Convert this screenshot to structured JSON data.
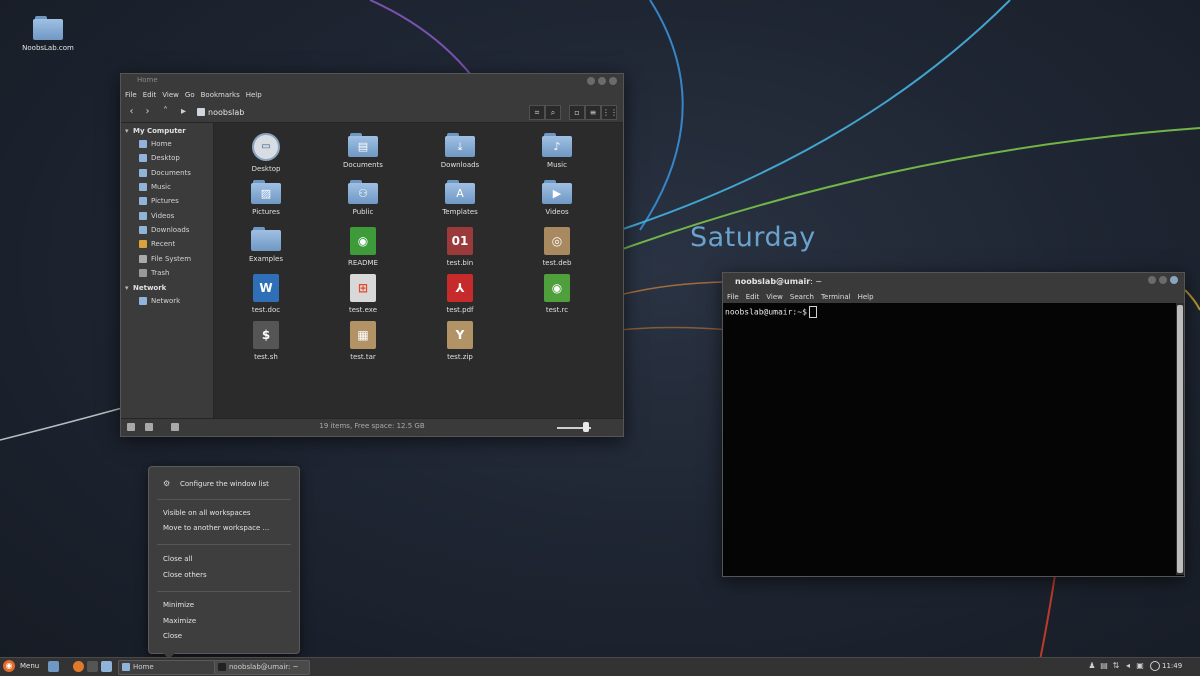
{
  "desktop": {
    "icon_label": "NoobsLab.com",
    "clock_day": "Saturday"
  },
  "file_manager": {
    "title": "Home",
    "menu": [
      "File",
      "Edit",
      "View",
      "Go",
      "Bookmarks",
      "Help"
    ],
    "location": "noobslab",
    "sidebar": {
      "section1": "My Computer",
      "items1": [
        "Home",
        "Desktop",
        "Documents",
        "Music",
        "Pictures",
        "Videos",
        "Downloads",
        "Recent",
        "File System",
        "Trash"
      ],
      "section2": "Network",
      "items2": [
        "Network"
      ]
    },
    "files": [
      {
        "name": "Desktop",
        "icon": "desktop-icon",
        "glyph": "▭"
      },
      {
        "name": "Documents",
        "icon": "folder-documents-icon",
        "glyph": "▤"
      },
      {
        "name": "Downloads",
        "icon": "folder-downloads-icon",
        "glyph": "⤓"
      },
      {
        "name": "Music",
        "icon": "folder-music-icon",
        "glyph": "♪"
      },
      {
        "name": "Pictures",
        "icon": "folder-pictures-icon",
        "glyph": "▨"
      },
      {
        "name": "Public",
        "icon": "folder-public-icon",
        "glyph": "⚇"
      },
      {
        "name": "Templates",
        "icon": "folder-templates-icon",
        "glyph": "A"
      },
      {
        "name": "Videos",
        "icon": "folder-videos-icon",
        "glyph": "▶"
      },
      {
        "name": "Examples",
        "icon": "folder-icon",
        "glyph": ""
      },
      {
        "name": "README",
        "icon": "text-file-icon",
        "glyph": "◉",
        "color": "#3d9b3a"
      },
      {
        "name": "test.bin",
        "icon": "binary-file-icon",
        "glyph": "01",
        "color": "#9b3a3a"
      },
      {
        "name": "test.deb",
        "icon": "deb-package-icon",
        "glyph": "◎",
        "color": "#a88960"
      },
      {
        "name": "test.doc",
        "icon": "document-file-icon",
        "glyph": "W",
        "color": "#2f6fb8"
      },
      {
        "name": "test.exe",
        "icon": "exe-file-icon",
        "glyph": "⊞",
        "color": "#d8d8d8"
      },
      {
        "name": "test.pdf",
        "icon": "pdf-file-icon",
        "glyph": "⅄",
        "color": "#c62a2a"
      },
      {
        "name": "test.rc",
        "icon": "rc-file-icon",
        "glyph": "◉",
        "color": "#4f9f3c"
      },
      {
        "name": "test.sh",
        "icon": "shell-script-icon",
        "glyph": "$",
        "color": "#555555"
      },
      {
        "name": "test.tar",
        "icon": "tar-archive-icon",
        "glyph": "▦",
        "color": "#b29366"
      },
      {
        "name": "test.zip",
        "icon": "zip-archive-icon",
        "glyph": "Y",
        "color": "#b29366"
      }
    ],
    "status": "19 items, Free space: 12.5 GB",
    "zoom_level": 0.85
  },
  "terminal": {
    "title_user": "noobslab@umair",
    "title_path": ": ~",
    "menu": [
      "File",
      "Edit",
      "View",
      "Search",
      "Terminal",
      "Help"
    ],
    "prompt": "noobslab@umair:~$"
  },
  "context_menu": {
    "configure": "Configure the window list",
    "visible_all": "Visible on all workspaces",
    "move_workspace": "Move to another workspace ...",
    "close_all": "Close all",
    "close_others": "Close others",
    "minimize": "Minimize",
    "maximize": "Maximize",
    "close": "Close"
  },
  "panel": {
    "menu_label": "Menu",
    "task1": "Home",
    "task2": "noobslab@umair: ~",
    "clock": "11:49"
  },
  "colors": {
    "accent_blue": "#6aa2cc",
    "menu_orange": "#e66b2a"
  }
}
